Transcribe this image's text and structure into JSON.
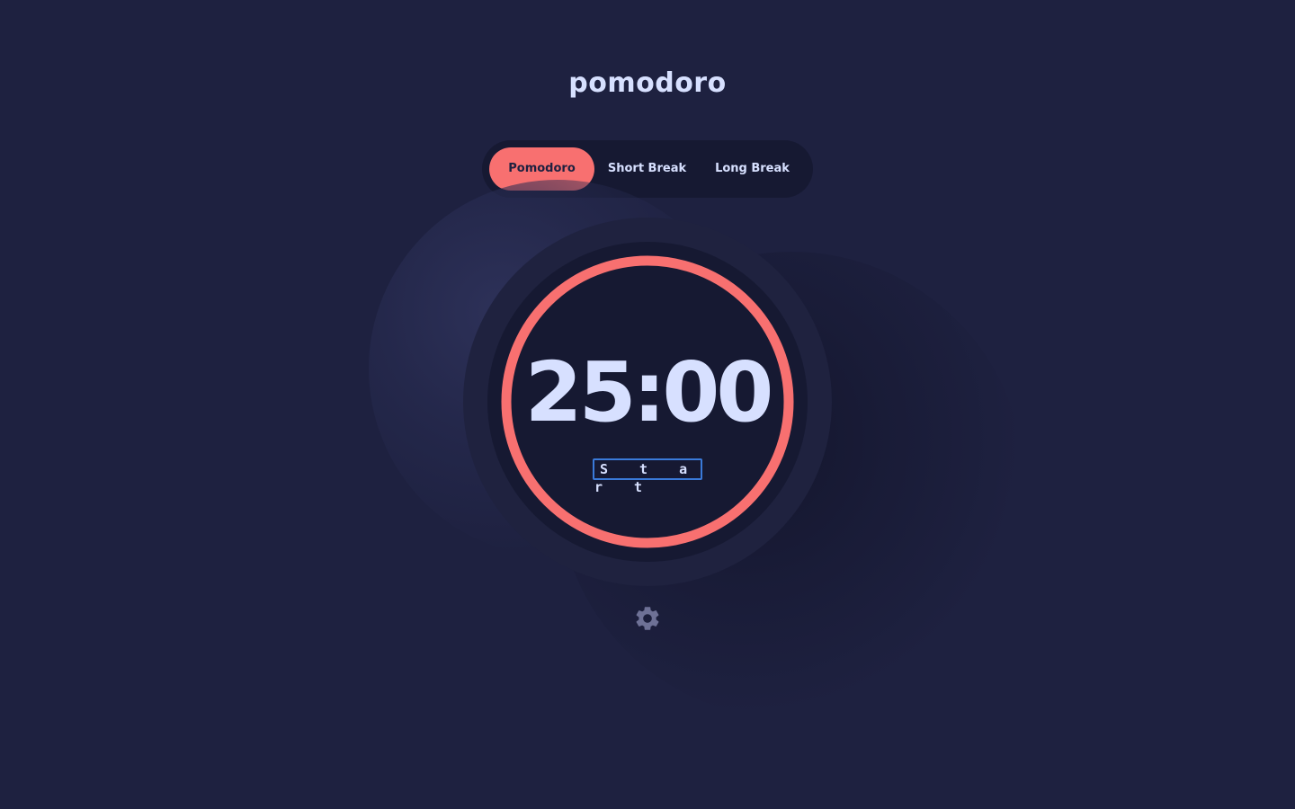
{
  "app": {
    "title": "pomodoro"
  },
  "modes": [
    {
      "label": "Pomodoro",
      "active": true
    },
    {
      "label": "Short Break",
      "active": false
    },
    {
      "label": "Long Break",
      "active": false
    }
  ],
  "timer": {
    "time": "25:00",
    "action_label": "S t a r t",
    "progress": 1.0
  },
  "icons": {
    "settings": "gear-icon"
  },
  "colors": {
    "background": "#1e2140",
    "panel": "#161932",
    "accent": "#f87070",
    "text": "#d7e0ff",
    "focus_ring": "#3a7ad9"
  }
}
